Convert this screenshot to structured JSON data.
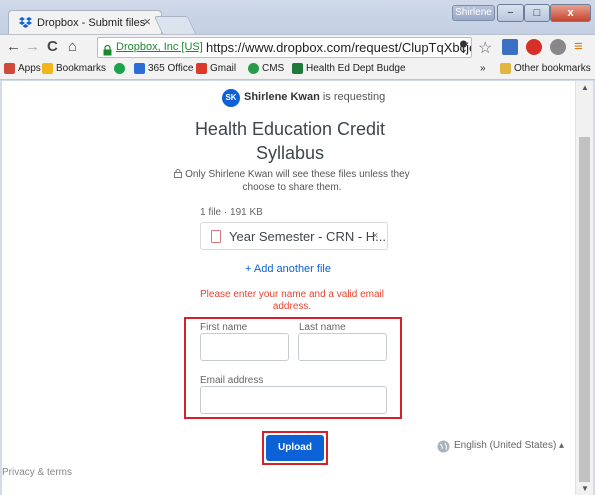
{
  "browser": {
    "tab_title": "Dropbox - Submit files",
    "tab_close": "×",
    "user_chip": "Shirlene",
    "window_min": "−",
    "window_max": "□",
    "window_close": "x",
    "nav_back": "←",
    "nav_forward": "→",
    "nav_reload": "C",
    "nav_home": "⌂",
    "ev_badge": "Dropbox, Inc [US]",
    "url": "https://www.dropbox.com/request/ClupTqXbcjeMNj",
    "star": "☆",
    "menu": "≡",
    "icons": {
      "tab_favicon": "dropbox-icon",
      "lock": "lock-icon",
      "pin": "map-pin-icon",
      "star": "star-icon",
      "extension_1": "puzzle-icon",
      "extension_2": "opera-icon",
      "extension_3": "extension-icon",
      "menu": "hamburger-menu-icon"
    }
  },
  "bookmarks": {
    "items": [
      {
        "label": "Apps",
        "color": "#d04a3a"
      },
      {
        "label": "Bookmarks",
        "color": "#f2b51a"
      },
      {
        "label": "",
        "color": "#1aa34a"
      },
      {
        "label": "365 Office",
        "color": "#2b6cd6"
      },
      {
        "label": "Gmail",
        "color": "#d93a2b"
      },
      {
        "label": "CMS",
        "color": "#2a9a4a"
      },
      {
        "label": "Health Ed Dept Budge",
        "color": "#1e7a3a"
      }
    ],
    "overflow": "»",
    "other": "Other bookmarks"
  },
  "request": {
    "avatar_initials": "SK",
    "requester": "Shirlene Kwan",
    "requesting_suffix": " is requesting",
    "title": "Health Education Credit Syllabus",
    "privacy_note": "Only Shirlene Kwan will see these files unless they choose to share them.",
    "file_count": "1 file · 191 KB",
    "file_name": "Year Semester - CRN - H...",
    "file_remove": "×",
    "add_another": "+ Add another file",
    "error": "Please enter your name and a valid email address.",
    "first_name_label": "First name",
    "last_name_label": "Last name",
    "email_label": "Email address",
    "first_name_value": "",
    "last_name_value": "",
    "email_value": "",
    "upload_label": "Upload",
    "language": "English (United States) ▴",
    "footer": "Privacy & terms",
    "accent_color": "#0d61d6",
    "error_color": "#e8412d"
  }
}
